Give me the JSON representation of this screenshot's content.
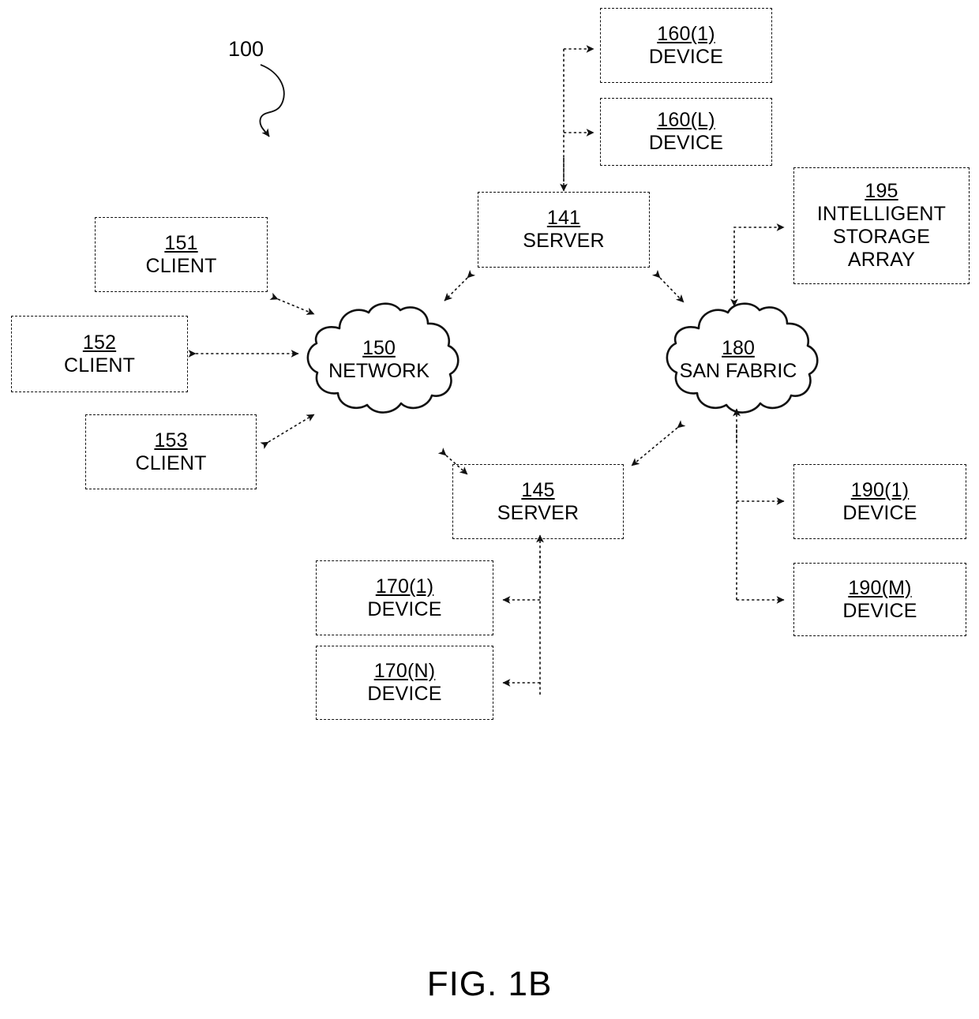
{
  "figure": {
    "caption": "FIG. 1B",
    "system_ref": "100"
  },
  "nodes": {
    "device_160_1": {
      "ref": "160(1)",
      "label": "DEVICE"
    },
    "device_160_L": {
      "ref": "160(L)",
      "label": "DEVICE"
    },
    "server_141": {
      "ref": "141",
      "label": "SERVER"
    },
    "client_151": {
      "ref": "151",
      "label": "CLIENT"
    },
    "client_152": {
      "ref": "152",
      "label": "CLIENT"
    },
    "client_153": {
      "ref": "153",
      "label": "CLIENT"
    },
    "network_150": {
      "ref": "150",
      "label": "NETWORK"
    },
    "san_fabric_180": {
      "ref": "180",
      "label": "SAN FABRIC"
    },
    "storage_195": {
      "ref": "195",
      "label": "INTELLIGENT\nSTORAGE\nARRAY"
    },
    "server_145": {
      "ref": "145",
      "label": "SERVER"
    },
    "device_170_1": {
      "ref": "170(1)",
      "label": "DEVICE"
    },
    "device_170_N": {
      "ref": "170(N)",
      "label": "DEVICE"
    },
    "device_190_1": {
      "ref": "190(1)",
      "label": "DEVICE"
    },
    "device_190_M": {
      "ref": "190(M)",
      "label": "DEVICE"
    }
  },
  "colors": {
    "line": "#111111",
    "text": "#000000",
    "background": "#ffffff"
  }
}
